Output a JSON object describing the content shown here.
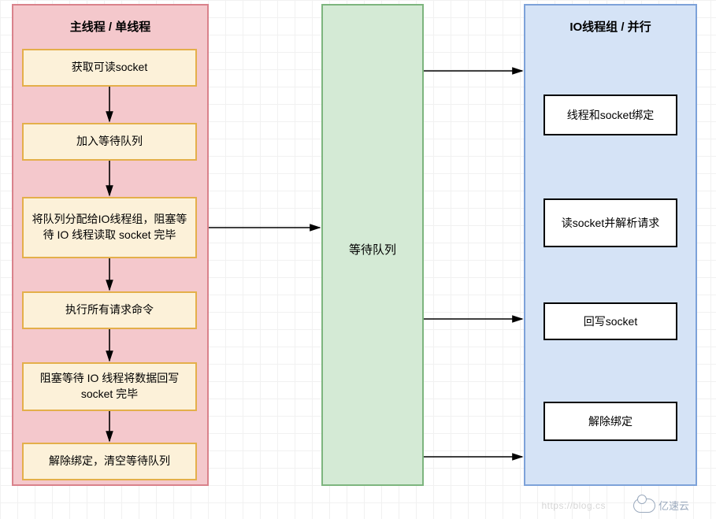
{
  "main_thread": {
    "title": "主线程 / 单线程",
    "steps": {
      "s1": "获取可读socket",
      "s2": "加入等待队列",
      "s3": "将队列分配给IO线程组，阻塞等待 IO 线程读取 socket 完毕",
      "s4": "执行所有请求命令",
      "s5": "阻塞等待 IO 线程将数据回写 socket 完毕",
      "s6": "解除绑定，清空等待队列"
    }
  },
  "queue": {
    "label": "等待队列"
  },
  "io_threads": {
    "title": "IO线程组 / 并行",
    "items": {
      "i1": "线程和socket绑定",
      "i2": "读socket并解析请求",
      "i3": "回写socket",
      "i4": "解除绑定"
    }
  },
  "watermark": {
    "brand": "亿速云",
    "url": "https://blog.cs"
  },
  "colors": {
    "red_border": "#d9828b",
    "red_fill": "#f4c8cc",
    "green_border": "#7db57e",
    "green_fill": "#d4ead5",
    "blue_border": "#7da2d9",
    "blue_fill": "#d5e3f6",
    "step_border": "#e4af4a",
    "step_fill": "#fcf1d9"
  },
  "chart_data": {
    "type": "flowchart",
    "lanes": [
      {
        "id": "main",
        "title": "主线程 / 单线程",
        "nodes": [
          "s1",
          "s2",
          "s3",
          "s4",
          "s5",
          "s6"
        ]
      },
      {
        "id": "queue",
        "title": "等待队列",
        "nodes": [
          "q"
        ]
      },
      {
        "id": "io",
        "title": "IO线程组 / 并行",
        "nodes": [
          "i1",
          "i2",
          "i3",
          "i4"
        ]
      }
    ],
    "nodes": {
      "s1": "获取可读socket",
      "s2": "加入等待队列",
      "s3": "将队列分配给IO线程组，阻塞等待 IO 线程读取 socket 完毕",
      "s4": "执行所有请求命令",
      "s5": "阻塞等待 IO 线程将数据回写 socket 完毕",
      "s6": "解除绑定，清空等待队列",
      "q": "等待队列",
      "i1": "线程和socket绑定",
      "i2": "读socket并解析请求",
      "i3": "回写socket",
      "i4": "解除绑定"
    },
    "edges": [
      [
        "s1",
        "s2"
      ],
      [
        "s2",
        "s3"
      ],
      [
        "s3",
        "s4"
      ],
      [
        "s4",
        "s5"
      ],
      [
        "s5",
        "s6"
      ],
      [
        "s3",
        "q"
      ],
      [
        "q",
        "i1_fanout"
      ],
      [
        "q",
        "i3_fanout"
      ],
      [
        "q",
        "i4_fanout"
      ]
    ]
  }
}
